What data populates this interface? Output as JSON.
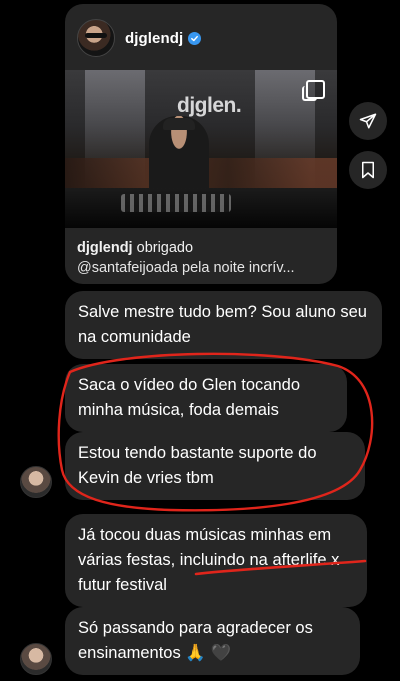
{
  "post": {
    "username": "djglendj",
    "verified": true,
    "image_overlay_text": "djglen.",
    "caption_user": "djglendj",
    "caption_text": "obrigado",
    "caption_line2": "@santafeijoada pela noite incrív..."
  },
  "messages": [
    {
      "text": "Salve mestre tudo bem? Sou aluno seu na comunidade"
    },
    {
      "text": "Saca o vídeo do Glen tocando minha música, foda demais"
    },
    {
      "text": "Estou tendo bastante suporte do Kevin de vries tbm"
    },
    {
      "text": "Já tocou duas músicas minhas em várias festas, incluindo na afterlife x futur festival"
    },
    {
      "text": "Só passando para agradecer os ensinamentos 🙏 🖤"
    }
  ],
  "icons": {
    "share": "paper-plane-icon",
    "save": "bookmark-icon",
    "multi": "carousel-icon",
    "verified": "verified-badge-icon"
  },
  "colors": {
    "bubble": "#262626",
    "background": "#000000",
    "annotation": "#e0251b",
    "verified": "#3897f0"
  }
}
